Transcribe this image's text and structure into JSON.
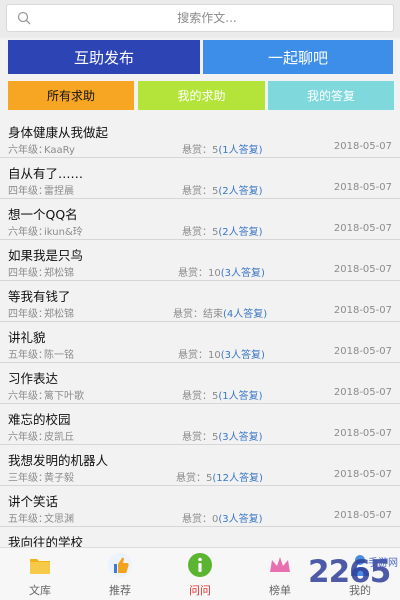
{
  "search": {
    "placeholder": "搜索作文..."
  },
  "actions": {
    "help_publish": "互助发布",
    "chat_together": "一起聊吧"
  },
  "tabs": {
    "all_help": "所有求助",
    "my_help": "我的求助",
    "my_answers": "我的答复"
  },
  "reward_label": "悬赏：",
  "questions": [
    {
      "title": "身体健康从我做起",
      "grade": "六年级：",
      "user": "KaaRy",
      "reward": "5",
      "answers": "(1人答复)",
      "date": "2018-05-07"
    },
    {
      "title": "自从有了……",
      "grade": "四年级：",
      "user": "雷捏晨",
      "reward": "5",
      "answers": "(2人答复)",
      "date": "2018-05-07"
    },
    {
      "title": "想一个QQ名",
      "grade": "六年级：",
      "user": "ikun&玲",
      "reward": "5",
      "answers": "(2人答复)",
      "date": "2018-05-07"
    },
    {
      "title": "如果我是只鸟",
      "grade": "四年级：",
      "user": "郑松锦",
      "reward": "10",
      "answers": "(3人答复)",
      "date": "2018-05-07"
    },
    {
      "title": "等我有钱了",
      "grade": "四年级：",
      "user": "郑松锦",
      "reward": "结束",
      "answers": "(4人答复)",
      "date": "2018-05-07"
    },
    {
      "title": "讲礼貌",
      "grade": "五年级：",
      "user": "陈一铭",
      "reward": "10",
      "answers": "(3人答复)",
      "date": "2018-05-07"
    },
    {
      "title": "习作表达",
      "grade": "六年级：",
      "user": "篱下叶歌",
      "reward": "5",
      "answers": "(1人答复)",
      "date": "2018-05-07"
    },
    {
      "title": "难忘的校园",
      "grade": "六年级：",
      "user": "皮凯丘",
      "reward": "5",
      "answers": "(3人答复)",
      "date": "2018-05-07"
    },
    {
      "title": "我想发明的机器人",
      "grade": "三年级：",
      "user": "黄子毅",
      "reward": "5",
      "answers": "(12人答复)",
      "date": "2018-05-07"
    },
    {
      "title": "讲个笑话",
      "grade": "五年级：",
      "user": "文思渊",
      "reward": "0",
      "answers": "(3人答复)",
      "date": "2018-05-07"
    },
    {
      "title": "我向往的学校"
    }
  ],
  "nav": {
    "library": {
      "label": "文库",
      "icon": "folder-icon"
    },
    "recommend": {
      "label": "推荐",
      "icon": "thumbs-up-icon"
    },
    "ask": {
      "label": "问问",
      "icon": "info-icon"
    },
    "ranking": {
      "label": "榜单",
      "icon": "crown-icon"
    },
    "mine": {
      "label": "我的",
      "icon": "user-icon"
    }
  },
  "watermark": {
    "text": "2265",
    "sub": "手游网"
  },
  "colors": {
    "help_publish": "#2d44b5",
    "chat_together": "#3d8ee9",
    "tab_all": "#f6a623",
    "tab_mine": "#b4e43a",
    "tab_answers": "#7fd9dc",
    "answers_link": "#3a76c6",
    "active_nav": "#e02f2f"
  }
}
